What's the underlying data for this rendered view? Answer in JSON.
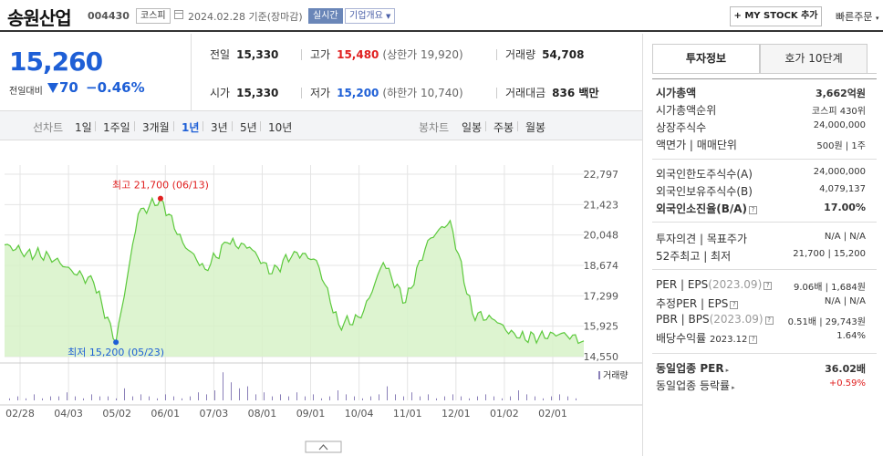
{
  "header": {
    "name": "송원산업",
    "code": "004430",
    "market": "코스피",
    "date": "2024.02.28  기준(장마감)",
    "realtime": "실시간",
    "company_info": "기업개요",
    "my_stock": "+ MY STOCK 추가",
    "quick_order": "빠른주문"
  },
  "price": {
    "current": "15,260",
    "change_label": "전일대비",
    "change": "70",
    "percent": "−0.46%",
    "direction": "down",
    "color": "#1e5fd6"
  },
  "stats": {
    "prev_close_label": "전일",
    "prev_close": "15,330",
    "high_label": "고가",
    "high": "15,480",
    "upper_limit": "(상한가 19,920)",
    "volume_label": "거래량",
    "volume": "54,708",
    "open_label": "시가",
    "open": "15,330",
    "low_label": "저가",
    "low": "15,200",
    "lower_limit": "(하한가 10,740)",
    "amount_label": "거래대금",
    "amount": "836 백만"
  },
  "toolbar": {
    "line_chart": "선차트",
    "periods": [
      "1일",
      "1주일",
      "3개월",
      "1년",
      "3년",
      "5년",
      "10년"
    ],
    "active_period": "1년",
    "candle_chart": "봉차트",
    "candles": [
      "일봉",
      "주봉",
      "월봉"
    ]
  },
  "chart_data": {
    "type": "area",
    "x": [
      "02/28",
      "03/15",
      "04/03",
      "04/18",
      "05/02",
      "05/23",
      "06/01",
      "06/13",
      "06/20",
      "07/03",
      "07/17",
      "08/01",
      "08/14",
      "09/01",
      "09/15",
      "10/04",
      "10/17",
      "11/01",
      "11/15",
      "12/01",
      "12/11",
      "12/28",
      "01/02",
      "01/15",
      "02/01",
      "02/15",
      "02/28"
    ],
    "y": [
      19600,
      19250,
      19100,
      18450,
      17900,
      15200,
      21000,
      21700,
      19700,
      18500,
      19700,
      19500,
      18300,
      19300,
      18900,
      16000,
      16300,
      18800,
      17000,
      19800,
      20700,
      16500,
      16200,
      15400,
      15450,
      15600,
      15260
    ],
    "ylim": [
      14550,
      22797
    ],
    "y_ticks": [
      "22,797",
      "21,423",
      "20,048",
      "18,674",
      "17,299",
      "15,925",
      "14,550"
    ],
    "x_ticks": [
      "02/28",
      "04/03",
      "05/02",
      "06/01",
      "07/03",
      "08/01",
      "09/01",
      "10/04",
      "11/01",
      "12/01",
      "01/02",
      "02/01"
    ],
    "annotations": {
      "high": {
        "label": "최고 21,700 (06/13)",
        "x": "06/13",
        "y": 21700,
        "color": "#e02020"
      },
      "low": {
        "label": "최저 15,200 (05/23)",
        "x": "05/23",
        "y": 15200,
        "color": "#1e5fd6"
      }
    },
    "volume_label": "거래량",
    "volume": [
      1,
      2,
      1,
      3,
      1,
      2,
      2,
      4,
      2,
      1,
      3,
      2,
      2,
      1,
      6,
      2,
      3,
      2,
      1,
      3,
      2,
      1,
      2,
      4,
      3,
      5,
      14,
      9,
      6,
      7,
      3,
      4,
      2,
      3,
      2,
      4,
      2,
      3,
      1,
      2,
      5,
      3,
      2,
      1,
      2,
      3,
      7,
      3,
      2,
      4,
      2,
      3,
      1,
      2,
      3,
      2,
      1,
      2,
      3,
      2,
      1,
      2,
      5,
      3,
      2,
      1,
      2,
      3,
      2,
      1
    ],
    "colors": {
      "line": "#5cc93c",
      "fill": "#d7f2c8",
      "grid": "#e4e4e4"
    }
  },
  "side": {
    "tabs": [
      "투자정보",
      "호가 10단계"
    ],
    "rows_a": [
      {
        "k": "시가총액",
        "v": "3,662억원"
      },
      {
        "k": "시가총액순위",
        "v": "코스피  430위"
      },
      {
        "k": "상장주식수",
        "v": "24,000,000"
      },
      {
        "k": "액면가 | 매매단위",
        "v": "500원 | 1주"
      }
    ],
    "rows_b": [
      {
        "k": "외국인한도주식수(A)",
        "v": "24,000,000"
      },
      {
        "k": "외국인보유주식수(B)",
        "v": "4,079,137"
      },
      {
        "k": "외국인소진율(B/A)",
        "v": "17.00%"
      }
    ],
    "rows_c": [
      {
        "k": "투자의견 | 목표주가",
        "v": "N/A | N/A"
      },
      {
        "k": "52주최고 | 최저",
        "v": "21,700 | 15,200"
      }
    ],
    "rows_d": [
      {
        "k": "PER | EPS",
        "k2": "(2023.09)",
        "v": "9.06배 | 1,684원"
      },
      {
        "k": "추정PER | EPS",
        "v": "N/A | N/A"
      },
      {
        "k": "PBR | BPS",
        "k2": "(2023.09)",
        "v": "0.51배 | 29,743원"
      },
      {
        "k": "배당수익률",
        "k2": "2023.12",
        "v": "1.64%"
      }
    ],
    "rows_e": [
      {
        "k": "동일업종 PER",
        "v": "36.02배"
      },
      {
        "k": "동일업종 등락률",
        "v": "+0.59%"
      }
    ]
  }
}
